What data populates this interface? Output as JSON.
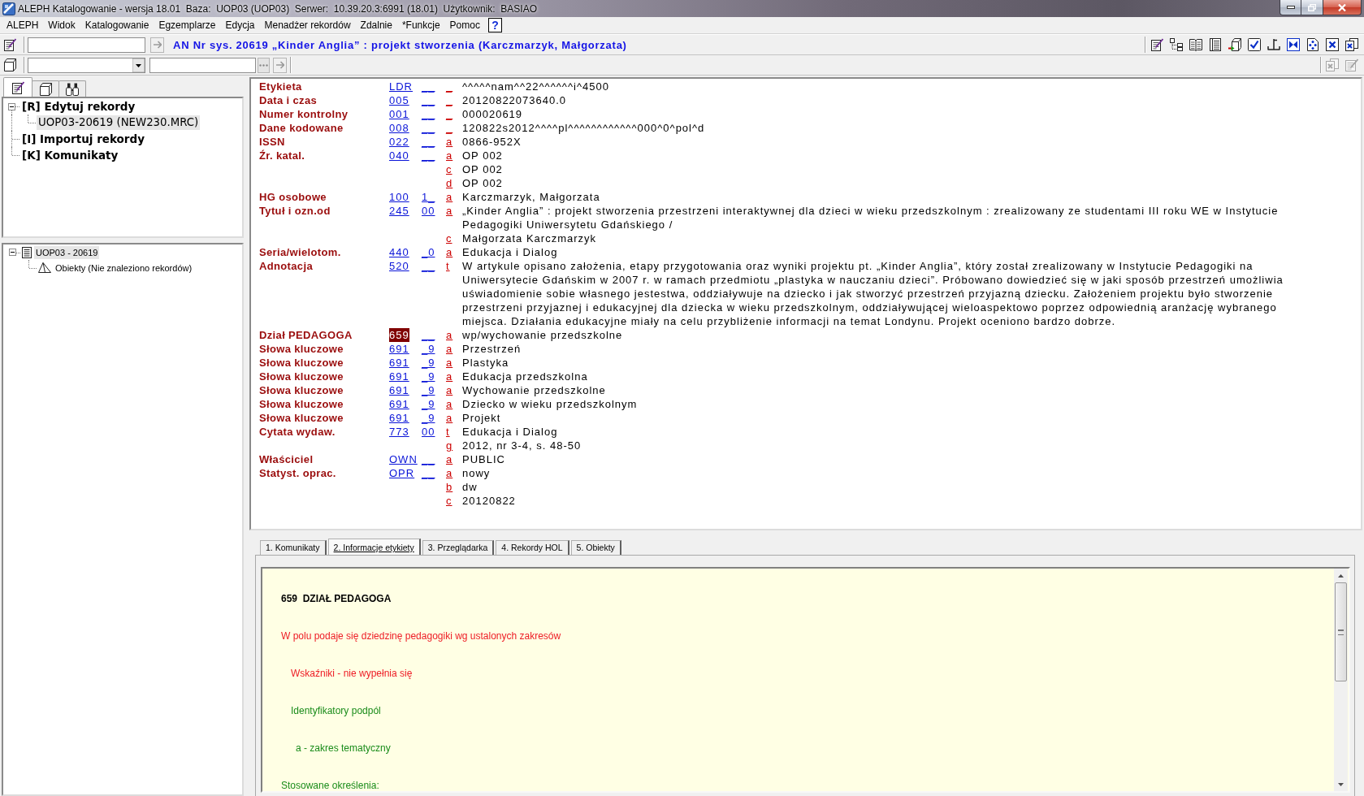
{
  "window": {
    "title": "ALEPH Katalogowanie - wersja 18.01  Baza:  UOP03 (UOP03)  Serwer:  10.39.20.3:6991 (18.01)  Użytkownik:  BASIAO"
  },
  "menu": {
    "items": [
      "ALEPH",
      "Widok",
      "Katalogowanie",
      "Egzemplarze",
      "Edycja",
      "Menadżer rekordów",
      "Zdalnie",
      "*Funkcje",
      "Pomoc"
    ],
    "help_button": "?"
  },
  "toolbar": {
    "record_title": "AN Nr sys. 20619 „Kinder Anglia” : projekt stworzenia (Karczmarzyk, Małgorzata)"
  },
  "left_panel": {
    "tabs": [
      {
        "selected": true
      },
      {
        "selected": false
      },
      {
        "selected": false
      }
    ],
    "tree": [
      {
        "label": "[R] Edytuj rekordy",
        "selected": false,
        "expanded": true,
        "children": [
          {
            "label": "UOP03-20619 (NEW230.MRC)",
            "selected": true
          }
        ]
      },
      {
        "label": "[I] Importuj rekordy",
        "selected": false
      },
      {
        "label": "[K] Komunikaty",
        "selected": false
      }
    ]
  },
  "object_tree": [
    {
      "label": "UOP03 - 20619",
      "selected": true,
      "expanded": true,
      "children": [
        {
          "label": "Obiekty (Nie znaleziono rekordów)",
          "selected": false
        }
      ]
    }
  ],
  "record": {
    "fields": [
      {
        "label": "Etykieta",
        "tag": "LDR",
        "ind": "__",
        "selected": false,
        "subfields": [
          {
            "code": "_",
            "value": "^^^^^nam^^22^^^^^^i^4500"
          }
        ]
      },
      {
        "label": "Data i czas",
        "tag": "005",
        "ind": "__",
        "selected": false,
        "subfields": [
          {
            "code": "_",
            "value": "20120822073640.0"
          }
        ]
      },
      {
        "label": "Numer kontrolny",
        "tag": "001",
        "ind": "__",
        "selected": false,
        "subfields": [
          {
            "code": "_",
            "value": "000020619"
          }
        ]
      },
      {
        "label": "Dane kodowane",
        "tag": "008",
        "ind": "__",
        "selected": false,
        "subfields": [
          {
            "code": "_",
            "value": "120822s2012^^^^pl^^^^^^^^^^^^000^0^pol^d"
          }
        ]
      },
      {
        "label": "ISSN",
        "tag": "022",
        "ind": "__",
        "selected": false,
        "subfields": [
          {
            "code": "a",
            "value": "0866-952X"
          }
        ]
      },
      {
        "label": "Źr. katal.",
        "tag": "040",
        "ind": "__",
        "selected": false,
        "subfields": [
          {
            "code": "a",
            "value": "OP 002"
          },
          {
            "code": "c",
            "value": "OP 002"
          },
          {
            "code": "d",
            "value": "OP 002"
          }
        ]
      },
      {
        "label": "HG osobowe",
        "tag": "100",
        "ind": "1_",
        "selected": false,
        "subfields": [
          {
            "code": "a",
            "value": "Karczmarzyk, Małgorzata"
          }
        ]
      },
      {
        "label": "Tytuł i ozn.od",
        "tag": "245",
        "ind": "00",
        "selected": false,
        "subfields": [
          {
            "code": "a",
            "value": "„Kinder Anglia” : projekt stworzenia przestrzeni interaktywnej dla dzieci w wieku przedszkolnym : zrealizowany ze studentami III roku WE w Instytucie Pedagogiki Uniwersytetu Gdańskiego /"
          },
          {
            "code": "c",
            "value": "Małgorzata Karczmarzyk"
          }
        ]
      },
      {
        "label": "Seria/wielotom.",
        "tag": "440",
        "ind": "_0",
        "selected": false,
        "subfields": [
          {
            "code": "a",
            "value": "Edukacja i Dialog"
          }
        ]
      },
      {
        "label": "Adnotacja",
        "tag": "520",
        "ind": "__",
        "selected": false,
        "subfields": [
          {
            "code": "t",
            "value": "W artykule opisano założenia, etapy przygotowania oraz wyniki projektu pt. „Kinder Anglia”, który został zrealizowany w Instytucie Pedagogiki na Uniwersytecie Gdańskim w 2007 r. w ramach przedmiotu „plastyka w nauczaniu dzieci”. Próbowano dowiedzieć się w jaki sposób przestrzeń umożliwia uświadomienie sobie własnego jestestwa, oddziaływuje na dziecko i jak stworzyć przestrzeń przyjazną dziecku. Założeniem projektu było stworzenie przestrzeni przyjaznej i edukacyjnej dla dziecka w wieku przedszkolnym, oddziaływującej wieloaspektowo poprzez odpowiednią aranżację wybranego miejsca. Działania edukacyjne miały na celu przybliżenie informacji na temat Londynu. Projekt oceniono bardzo dobrze."
          }
        ]
      },
      {
        "label": "Dział PEDAGOGA",
        "tag": "659",
        "ind": "__",
        "selected": true,
        "subfields": [
          {
            "code": "a",
            "value": "wp/wychowanie przedszkolne"
          }
        ]
      },
      {
        "label": "Słowa kluczowe",
        "tag": "691",
        "ind": "_9",
        "selected": false,
        "subfields": [
          {
            "code": "a",
            "value": "Przestrzeń"
          }
        ]
      },
      {
        "label": "Słowa kluczowe",
        "tag": "691",
        "ind": "_9",
        "selected": false,
        "subfields": [
          {
            "code": "a",
            "value": "Plastyka"
          }
        ]
      },
      {
        "label": "Słowa kluczowe",
        "tag": "691",
        "ind": "_9",
        "selected": false,
        "subfields": [
          {
            "code": "a",
            "value": "Edukacja przedszkolna"
          }
        ]
      },
      {
        "label": "Słowa kluczowe",
        "tag": "691",
        "ind": "_9",
        "selected": false,
        "subfields": [
          {
            "code": "a",
            "value": "Wychowanie przedszkolne"
          }
        ]
      },
      {
        "label": "Słowa kluczowe",
        "tag": "691",
        "ind": "_9",
        "selected": false,
        "subfields": [
          {
            "code": "a",
            "value": "Dziecko w wieku przedszkolnym"
          }
        ]
      },
      {
        "label": "Słowa kluczowe",
        "tag": "691",
        "ind": "_9",
        "selected": false,
        "subfields": [
          {
            "code": "a",
            "value": "Projekt"
          }
        ]
      },
      {
        "label": "Cytata wydaw.",
        "tag": "773",
        "ind": "00",
        "selected": false,
        "subfields": [
          {
            "code": "t",
            "value": "Edukacja i Dialog"
          },
          {
            "code": "g",
            "value": "2012, nr 3-4, s. 48-50"
          }
        ]
      },
      {
        "label": "Właściciel",
        "tag": "OWN",
        "ind": "__",
        "selected": false,
        "subfields": [
          {
            "code": "a",
            "value": "PUBLIC"
          }
        ]
      },
      {
        "label": "Statyst. oprac.",
        "tag": "OPR",
        "ind": "__",
        "selected": false,
        "subfields": [
          {
            "code": "a",
            "value": "nowy"
          },
          {
            "code": "b",
            "value": "dw"
          },
          {
            "code": "c",
            "value": "20120822"
          }
        ]
      }
    ]
  },
  "info_tabs": [
    {
      "label": "1. Komunikaty",
      "selected": false
    },
    {
      "label": "2. Informacje etykiety",
      "selected": true
    },
    {
      "label": "3. Przeglądarka",
      "selected": false
    },
    {
      "label": "4. Rekordy HOL",
      "selected": false
    },
    {
      "label": "5. Obiekty",
      "selected": false
    }
  ],
  "help": {
    "lines": [
      {
        "kind": "heading",
        "text": "659  DZIAŁ PEDAGOGA"
      },
      {
        "kind": "description",
        "text": "W polu podaje się dziedzinę pedagogiki wg ustalonych zakresów"
      },
      {
        "kind": "indicators",
        "text": "Wskaźniki - nie wypełnia się"
      },
      {
        "kind": "subfield_header",
        "text": "Identyfikatory podpól"
      },
      {
        "kind": "subfield",
        "text": "a - zakres tematyczny"
      },
      {
        "kind": "terms",
        "text": "Stosowane określenia:"
      }
    ]
  }
}
